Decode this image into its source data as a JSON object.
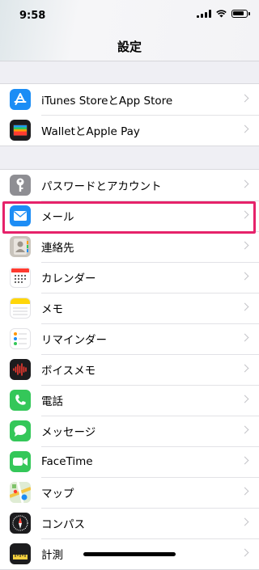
{
  "status": {
    "time": "9:58"
  },
  "header": {
    "title": "設定"
  },
  "groups": [
    {
      "items": [
        {
          "label": "iTunes StoreとApp Store",
          "icon": "app-store-icon",
          "color": "#1b8df5"
        },
        {
          "label": "WalletとApple Pay",
          "icon": "wallet-icon",
          "color": "#1c1c1e"
        }
      ]
    },
    {
      "items": [
        {
          "label": "パスワードとアカウント",
          "icon": "key-icon",
          "color": "#8e8e93"
        },
        {
          "label": "メール",
          "icon": "mail-icon",
          "color": "#1d8df5"
        },
        {
          "label": "連絡先",
          "icon": "contacts-icon",
          "color": "#c9c4bc"
        },
        {
          "label": "カレンダー",
          "icon": "calendar-icon",
          "color": "#ffffff"
        },
        {
          "label": "メモ",
          "icon": "notes-icon",
          "color": "#ffd60a"
        },
        {
          "label": "リマインダー",
          "icon": "reminders-icon",
          "color": "#ffffff"
        },
        {
          "label": "ボイスメモ",
          "icon": "voice-memos-icon",
          "color": "#1c1c1e"
        },
        {
          "label": "電話",
          "icon": "phone-icon",
          "color": "#34c759"
        },
        {
          "label": "メッセージ",
          "icon": "messages-icon",
          "color": "#34c759"
        },
        {
          "label": "FaceTime",
          "icon": "facetime-icon",
          "color": "#34c759"
        },
        {
          "label": "マップ",
          "icon": "maps-icon",
          "color": "#7fc36a"
        },
        {
          "label": "コンパス",
          "icon": "compass-icon",
          "color": "#1c1c1e"
        },
        {
          "label": "計測",
          "icon": "measure-icon",
          "color": "#1c1c1e"
        }
      ]
    }
  ],
  "highlight_color": "#e6226a"
}
